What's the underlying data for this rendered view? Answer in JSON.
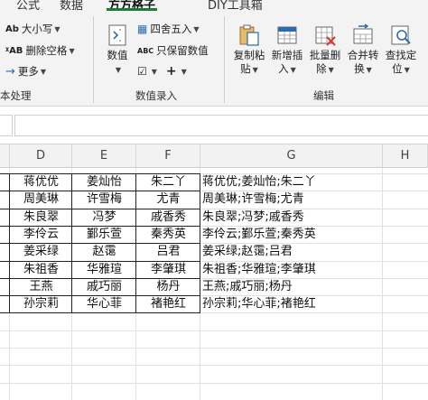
{
  "ribbon_tabs": [
    {
      "label": "公式"
    },
    {
      "label": "数据"
    },
    {
      "label": "方方格子"
    },
    {
      "label": "DIY工具箱"
    }
  ],
  "text_group": {
    "case_label": "大小写",
    "remove_space_label": "删除空格",
    "more_label": "更多",
    "group_label": "本处理"
  },
  "number_group": {
    "numeric_label": "数值",
    "round_label": "四舍五入",
    "keep_value_label": "只保留数值",
    "group_label": "数值录入"
  },
  "edit_group": {
    "buttons": [
      {
        "line1": "复制粘",
        "line2": "贴"
      },
      {
        "line1": "新增插",
        "line2": "入"
      },
      {
        "line1": "批量删",
        "line2": "除"
      },
      {
        "line1": "合并转",
        "line2": "换"
      },
      {
        "line1": "查找定",
        "line2": "位"
      }
    ],
    "group_label": "编辑"
  },
  "columns": [
    "D",
    "E",
    "F",
    "G",
    "H"
  ],
  "rows": [
    {
      "d": "蒋优优",
      "e": "姜灿怡",
      "f": "朱二丫",
      "g": "蒋优优;姜灿怡;朱二丫"
    },
    {
      "d": "周美琳",
      "e": "许雪梅",
      "f": "尤青",
      "g": "周美琳;许雪梅;尤青"
    },
    {
      "d": "朱良翠",
      "e": "冯梦",
      "f": "戚香秀",
      "g": "朱良翠;冯梦;戚香秀"
    },
    {
      "d": "李伶云",
      "e": "鄞乐萱",
      "f": "秦秀英",
      "g": "李伶云;鄞乐萱;秦秀英"
    },
    {
      "d": "姜采绿",
      "e": "赵霭",
      "f": "吕君",
      "g": "姜采绿;赵霭;吕君"
    },
    {
      "d": "朱祖香",
      "e": "华雅瑄",
      "f": "李肇琪",
      "g": "朱祖香;华雅瑄;李肇琪"
    },
    {
      "d": "王燕",
      "e": "戚巧丽",
      "f": "杨丹",
      "g": "王燕;戚巧丽;杨丹"
    },
    {
      "d": "孙宗莉",
      "e": "华心菲",
      "f": "褚艳红",
      "g": "孙宗莉;华心菲;褚艳红"
    }
  ],
  "colors": {
    "accent": "#1f7a3a",
    "ribbon_bg": "#f3f3f3",
    "icon_blue": "#2b6cb0",
    "icon_orange": "#e08a1e"
  }
}
